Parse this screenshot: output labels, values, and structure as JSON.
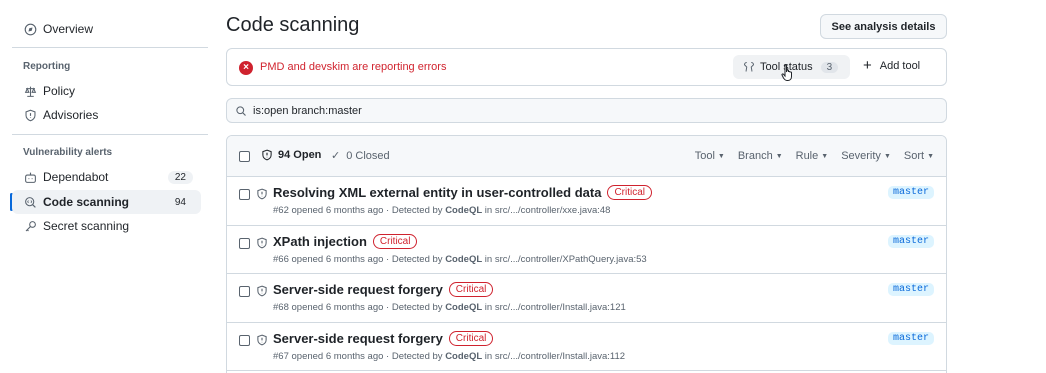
{
  "sidebar": {
    "overview": "Overview",
    "reporting_heading": "Reporting",
    "policy": "Policy",
    "advisories": "Advisories",
    "vuln_heading": "Vulnerability alerts",
    "dependabot": {
      "label": "Dependabot",
      "count": "22"
    },
    "code_scanning": {
      "label": "Code scanning",
      "count": "94"
    },
    "secret_scanning": "Secret scanning"
  },
  "header": {
    "title": "Code scanning",
    "details_button": "See analysis details"
  },
  "alert": {
    "message": "PMD and devskim are reporting errors",
    "tool_status_label": "Tool status",
    "tool_status_count": "3",
    "add_tool_label": "Add tool"
  },
  "search": {
    "value": "is:open branch:master"
  },
  "list": {
    "open_label": "94 Open",
    "closed_label": "0 Closed",
    "filters": [
      "Tool",
      "Branch",
      "Rule",
      "Severity",
      "Sort"
    ],
    "rows": [
      {
        "title": "Resolving XML external entity in user-controlled data",
        "severity": "Critical",
        "number": "#62",
        "opened": "opened 6 months ago",
        "detected_prefix": "· Detected by",
        "tool": "CodeQL",
        "location": "in src/.../controller/xxe.java:48",
        "branch": "master"
      },
      {
        "title": "XPath injection",
        "severity": "Critical",
        "number": "#66",
        "opened": "opened 6 months ago",
        "detected_prefix": "· Detected by",
        "tool": "CodeQL",
        "location": "in src/.../controller/XPathQuery.java:53",
        "branch": "master"
      },
      {
        "title": "Server-side request forgery",
        "severity": "Critical",
        "number": "#68",
        "opened": "opened 6 months ago",
        "detected_prefix": "· Detected by",
        "tool": "CodeQL",
        "location": "in src/.../controller/Install.java:121",
        "branch": "master"
      },
      {
        "title": "Server-side request forgery",
        "severity": "Critical",
        "number": "#67",
        "opened": "opened 6 months ago",
        "detected_prefix": "· Detected by",
        "tool": "CodeQL",
        "location": "in src/.../controller/Install.java:112",
        "branch": "master"
      }
    ]
  },
  "colors": {
    "accent": "#0969da",
    "danger": "#cf222e",
    "muted": "#59636e",
    "border": "#d1d9e0"
  }
}
